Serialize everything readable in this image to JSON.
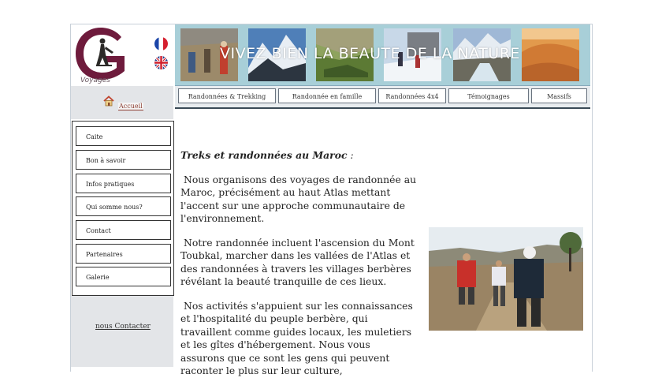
{
  "logo": {
    "letter": "G",
    "subtitle": "Voyages"
  },
  "banner": {
    "title": "VIVEZ BIEN LA BEAUTE DE LA NATURE"
  },
  "nav": [
    {
      "label": "Randonnées & Trekking"
    },
    {
      "label": "Randonnée en famille"
    },
    {
      "label": "Randonnées 4x4"
    },
    {
      "label": "Témoignages"
    },
    {
      "label": "Massifs"
    }
  ],
  "sidebar": {
    "home_label": "Accueil",
    "items": [
      {
        "label": "Caite"
      },
      {
        "label": "Bon à savoir"
      },
      {
        "label": "Infos pratiques"
      },
      {
        "label": "Qui somme nous?"
      },
      {
        "label": "Contact"
      },
      {
        "label": "Partenaires"
      },
      {
        "label": "Galerie"
      }
    ],
    "contact_link": "nous Contacter"
  },
  "content": {
    "heading": "Treks et randonnées au Maroc",
    "heading_suffix": " :",
    "paragraphs": [
      "Nous organisons des voyages de randonnée au Maroc, précisément au  haut Atlas mettant l'accent sur une approche communautaire de l'environnement.",
      "Notre randonnée incluent l'ascension du Mont Toubkal, marcher dans les vallées de l'Atlas et des randonnées à travers les villages berbères révélant la beauté tranquille de ces lieux.",
      "Nos activités s'appuient sur les connaissances et l'hospitalité du peuple berbère, qui travaillent comme guides locaux, les muletiers et les gîtes d'hébergement. Nous vous assurons que ce sont les gens qui peuvent raconter le plus sur leur culture,"
    ]
  },
  "colors": {
    "banner_bg": "#a8cfd8",
    "accent": "#8b3b2e",
    "logo": "#6e1b3c"
  }
}
